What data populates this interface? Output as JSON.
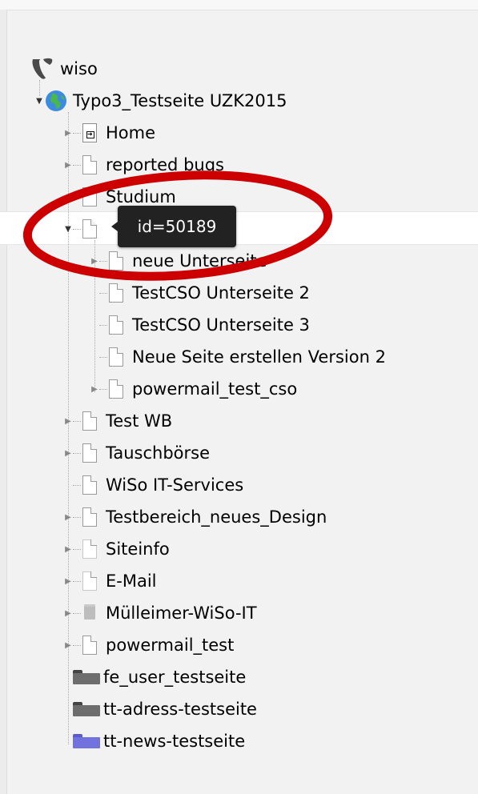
{
  "tree": {
    "root": {
      "label": "wiso",
      "icon": "typo3-logo-icon"
    },
    "site": {
      "label": "Typo3_Testseite UZK2015",
      "icon": "globe-icon",
      "expanded": true
    },
    "items": [
      {
        "label": "Home",
        "icon": "shortcut-page-icon",
        "expandable": true
      },
      {
        "label": "reported bugs",
        "icon": "page-icon",
        "expandable": true
      },
      {
        "label": "Studium",
        "icon": "page-icon",
        "expandable": false
      },
      {
        "label": "",
        "icon": "page-icon",
        "expandable": true,
        "expanded": true,
        "selected": true,
        "children": [
          {
            "label": "neue Unterseite",
            "icon": "page-icon",
            "expandable": true
          },
          {
            "label": "TestCSO Unterseite 2",
            "icon": "page-icon",
            "expandable": false
          },
          {
            "label": "TestCSO Unterseite 3",
            "icon": "page-icon",
            "expandable": false
          },
          {
            "label": "Neue Seite erstellen Version 2",
            "icon": "page-icon",
            "expandable": false
          },
          {
            "label": "powermail_test_cso",
            "icon": "page-icon",
            "expandable": true
          }
        ]
      },
      {
        "label": "Test WB",
        "icon": "page-icon",
        "expandable": true
      },
      {
        "label": "Tauschbörse",
        "icon": "page-icon",
        "expandable": true
      },
      {
        "label": "WiSo IT-Services",
        "icon": "page-icon",
        "expandable": false
      },
      {
        "label": "Testbereich_neues_Design",
        "icon": "page-icon",
        "expandable": true
      },
      {
        "label": "Siteinfo",
        "icon": "page-icon",
        "expandable": true
      },
      {
        "label": "E-Mail",
        "icon": "page-icon",
        "expandable": true
      },
      {
        "label": "Mülleimer-WiSo-IT",
        "icon": "trash-icon",
        "expandable": true
      },
      {
        "label": "powermail_test",
        "icon": "page-icon",
        "expandable": true
      },
      {
        "label": "fe_user_testseite",
        "icon": "folder-icon",
        "expandable": false
      },
      {
        "label": "tt-adress-testseite",
        "icon": "folder-icon",
        "expandable": false
      },
      {
        "label": "tt-news-testseite",
        "icon": "folder-blue-icon",
        "expandable": false
      }
    ]
  },
  "tooltip": {
    "text": "id=50189"
  },
  "colors": {
    "annotation": "#cc0000",
    "folder_blue": "#7272de",
    "tooltip_bg": "#222222",
    "selected_row_bg": "#ffffff"
  }
}
